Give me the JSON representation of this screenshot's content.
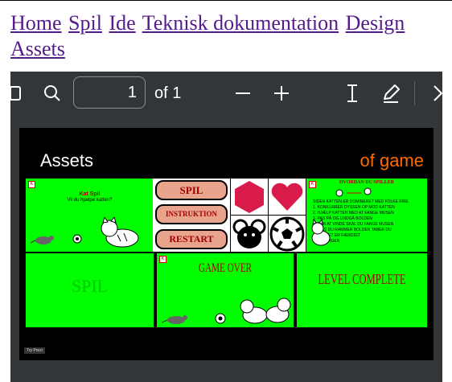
{
  "nav": {
    "links": [
      "Home",
      "Spil",
      "Ide",
      "Teknisk dokumentation",
      "Design",
      "Assets"
    ]
  },
  "toolbar": {
    "page_number": "1",
    "page_of": "of 1",
    "icons": [
      "sidebar-toggle-icon",
      "search-icon",
      "zoom-out-icon",
      "zoom-in-icon",
      "text-cursor-icon",
      "annotate-pen-icon",
      "chevron-right-icon"
    ]
  },
  "slide": {
    "title": "Assets",
    "subtitle": "of game",
    "subtitle_color": "#ff6a00",
    "panel_color": "#00ff00",
    "start_screen": {
      "title": "Kat Spil",
      "question": "Vil du hjælpe katten?"
    },
    "buttons": [
      "SPIL",
      "INSTRUKTION",
      "RESTART"
    ],
    "instructions": {
      "title": "HVORDAN DU SPILLER",
      "lines": [
        "SIDEN KATTEN ER DOMINERET MED FOLKE FRIE",
        "1. KONKURRER DYSSEN OP MOD KATTEN",
        "2. HJÆLP KATTEN MED AT FANGE MUSEN",
        "3. PAS PÅ OG UNDGÅ BOLDEN",
        "4. FOR AT VINDE SKAL DU FANGE MUSEN",
        "5. HVIS DU RAMMER BOLDEN TABER DU",
        "6. SPILLET ER FÆRDIGT",
        "7. PRØV IGEN"
      ]
    },
    "spil_label": "SPIL",
    "game_over_label": "GAME OVER",
    "level_complete_label": "LEVEL COMPLETE",
    "try_button": "Try Prezi"
  }
}
